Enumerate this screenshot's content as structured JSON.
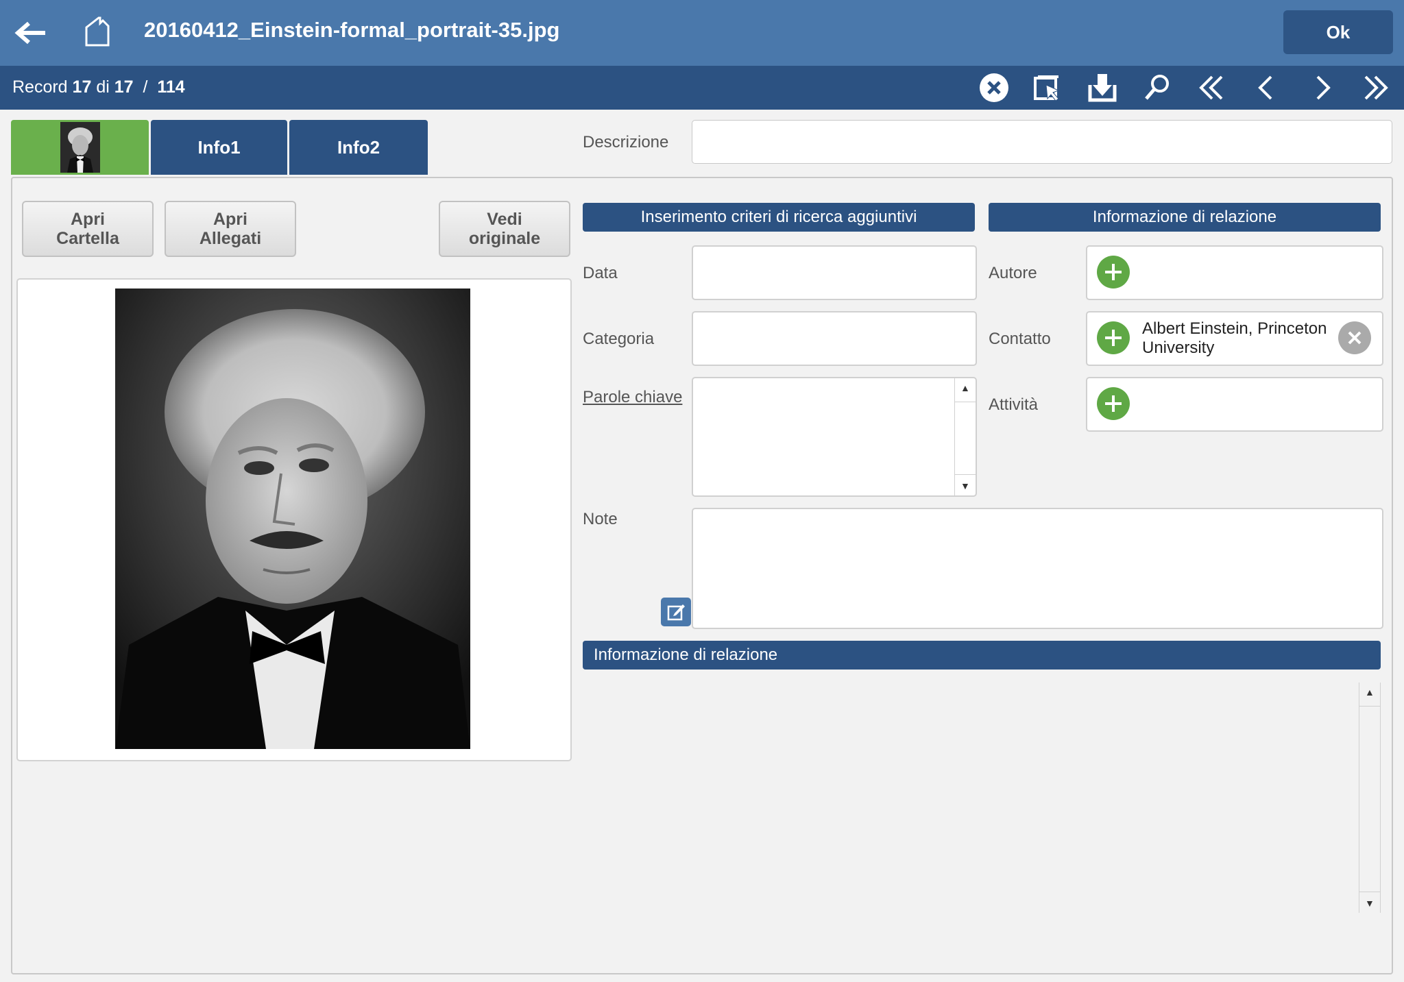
{
  "header": {
    "title": "20160412_Einstein-formal_portrait-35.jpg",
    "ok_label": "Ok"
  },
  "record_bar": {
    "prefix": "Record",
    "current": "17",
    "of_word": "di",
    "total": "17",
    "separator": "/",
    "overall": "114"
  },
  "tabs": [
    {
      "label": ""
    },
    {
      "label": "Info1"
    },
    {
      "label": "Info2"
    }
  ],
  "description": {
    "label": "Descrizione",
    "value": ""
  },
  "buttons": {
    "open_folder": [
      "Apri",
      "Cartella"
    ],
    "open_attachments": [
      "Apri",
      "Allegati"
    ],
    "view_original": [
      "Vedi",
      "originale"
    ]
  },
  "search_section": {
    "title": "Inserimento criteri di ricerca aggiuntivi",
    "data_label": "Data",
    "category_label": "Categoria",
    "keywords_label": "Parole chiave"
  },
  "relation_section": {
    "title": "Informazione di relazione",
    "author_label": "Autore",
    "contact_label": "Contatto",
    "contact_value": "Albert Einstein, Princeton University",
    "activity_label": "Attività"
  },
  "notes": {
    "label": "Note",
    "value": ""
  },
  "relation_info_bottom": {
    "title": "Informazione di relazione"
  },
  "icons": [
    "back-arrow-icon",
    "home-icon",
    "close-circle-icon",
    "select-cursor-icon",
    "download-icon",
    "search-icon",
    "first-record-icon",
    "previous-record-icon",
    "next-record-icon",
    "last-record-icon",
    "plus-icon",
    "remove-icon",
    "edit-icon"
  ],
  "colors": {
    "topbar": "#4a78ab",
    "recbar": "#2c5282",
    "green": "#6ab04c",
    "plus": "#5fa845"
  }
}
